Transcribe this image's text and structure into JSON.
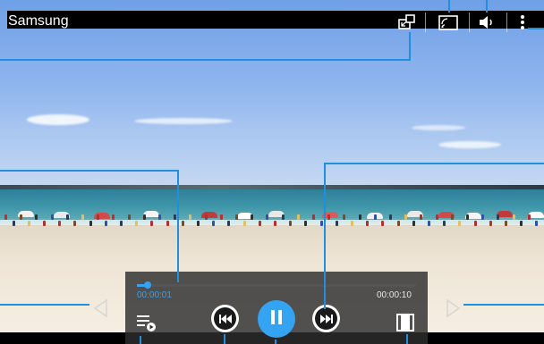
{
  "app": {
    "title": "Samsung"
  },
  "toolbar": {
    "popup_play": "popup-play-icon",
    "screen_mirroring": "screen-mirroring-icon",
    "volume": "volume-icon",
    "more_options": "more-options-icon"
  },
  "playback": {
    "elapsed": "00:00:01",
    "total": "00:00:10",
    "progress": 0.1,
    "state": "playing"
  },
  "controls": {
    "playlist": "playlist-icon",
    "rewind": "rewind-icon",
    "pause": "pause-icon",
    "fast_forward": "fast-forward-icon",
    "screen_ratio": "screen-ratio-icon",
    "prev_arrow": "left-arrow-icon",
    "next_arrow": "right-arrow-icon"
  },
  "colors": {
    "accent": "#33a3f2",
    "callout": "#1f8fde",
    "bar": "#000000",
    "panel": "#2d2d2d"
  }
}
